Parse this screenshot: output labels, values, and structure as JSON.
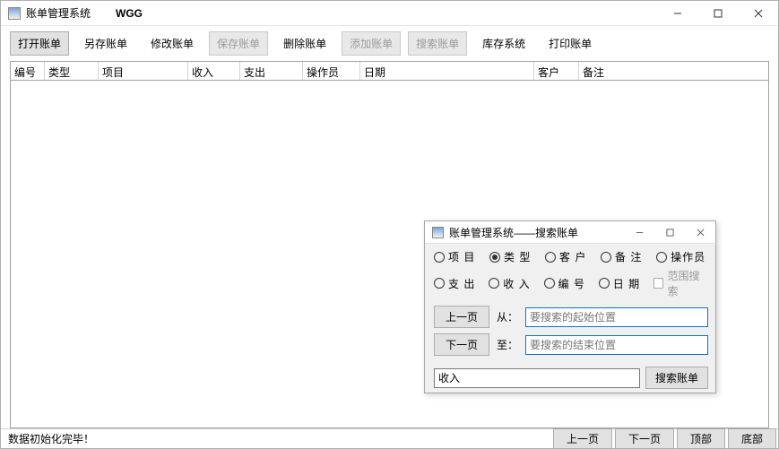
{
  "window": {
    "title": "账单管理系统",
    "subtitle": "WGG"
  },
  "toolbar": {
    "open": "打开账单",
    "saveas": "另存账单",
    "modify": "修改账单",
    "save": "保存账单",
    "delete": "删除账单",
    "add": "添加账单",
    "search": "搜索账单",
    "stock": "库存系统",
    "print": "打印账单"
  },
  "columns": {
    "no": "编号",
    "type": "类型",
    "item": "项目",
    "income": "收入",
    "expense": "支出",
    "operator": "操作员",
    "date": "日期",
    "customer": "客户",
    "remark": "备注"
  },
  "status": {
    "text": "数据初始化完毕！",
    "prev": "上一页",
    "next": "下一页",
    "top": "顶部",
    "bottom": "底部"
  },
  "dialog": {
    "title": "账单管理系统——搜索账单",
    "radios": {
      "project": "项 目",
      "type": "类 型",
      "customer": "客 户",
      "remark": "备 注",
      "operator": "操作员",
      "expense": "支 出",
      "income": "收 入",
      "no": "编 号",
      "date": "日 期"
    },
    "rangeSearch": "范围搜索",
    "prev": "上一页",
    "next": "下一页",
    "fromLabel": "从：",
    "toLabel": "至：",
    "fromPlaceholder": "要搜索的起始位置",
    "toPlaceholder": "要搜索的结束位置",
    "queryValue": "收入",
    "searchBtn": "搜索账单"
  }
}
